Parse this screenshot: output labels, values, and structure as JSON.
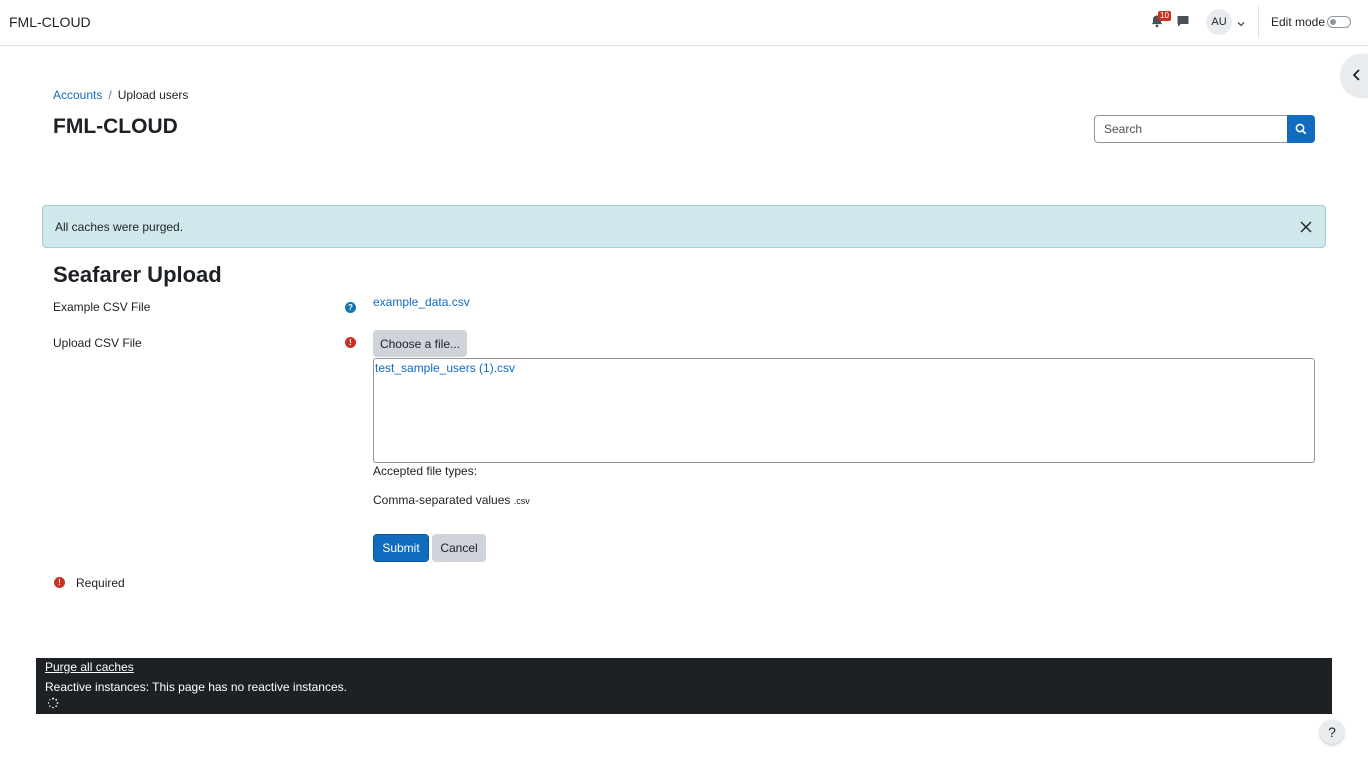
{
  "navbar": {
    "brand": "FML-CLOUD",
    "notification_count": "10",
    "avatar_initials": "AU",
    "edit_mode_label": "Edit mode"
  },
  "breadcrumb": {
    "items": [
      {
        "label": "Accounts"
      },
      {
        "label": "Upload users"
      }
    ],
    "separator": "/"
  },
  "page": {
    "title": "FML-CLOUD"
  },
  "search": {
    "placeholder": "Search"
  },
  "alert": {
    "message": "All caches were purged."
  },
  "form": {
    "title": "Seafarer Upload",
    "example_label": "Example CSV File",
    "example_link": "example_data.csv",
    "upload_label": "Upload CSV File",
    "choose_button": "Choose a file...",
    "selected_file": "test_sample_users (1).csv",
    "accepted_label": "Accepted file types:",
    "accepted_type": "Comma-separated values",
    "accepted_ext": ".csv",
    "submit": "Submit",
    "cancel": "Cancel",
    "required_note": "Required"
  },
  "footer": {
    "purge_link": "Purge all caches",
    "reactive_text": "Reactive instances: This page has no reactive instances."
  },
  "help": {
    "label": "?"
  },
  "icons": {
    "help": "help-icon",
    "required": "exclamation-icon",
    "close": "close-icon",
    "search": "search-icon",
    "bell": "bell-icon",
    "chat": "chat-icon"
  },
  "colors": {
    "primary": "#0f6cbf",
    "alert_bg": "#cfe8ec",
    "danger": "#ca3120",
    "info": "#1177a8",
    "footer_bg": "#1d2125"
  }
}
